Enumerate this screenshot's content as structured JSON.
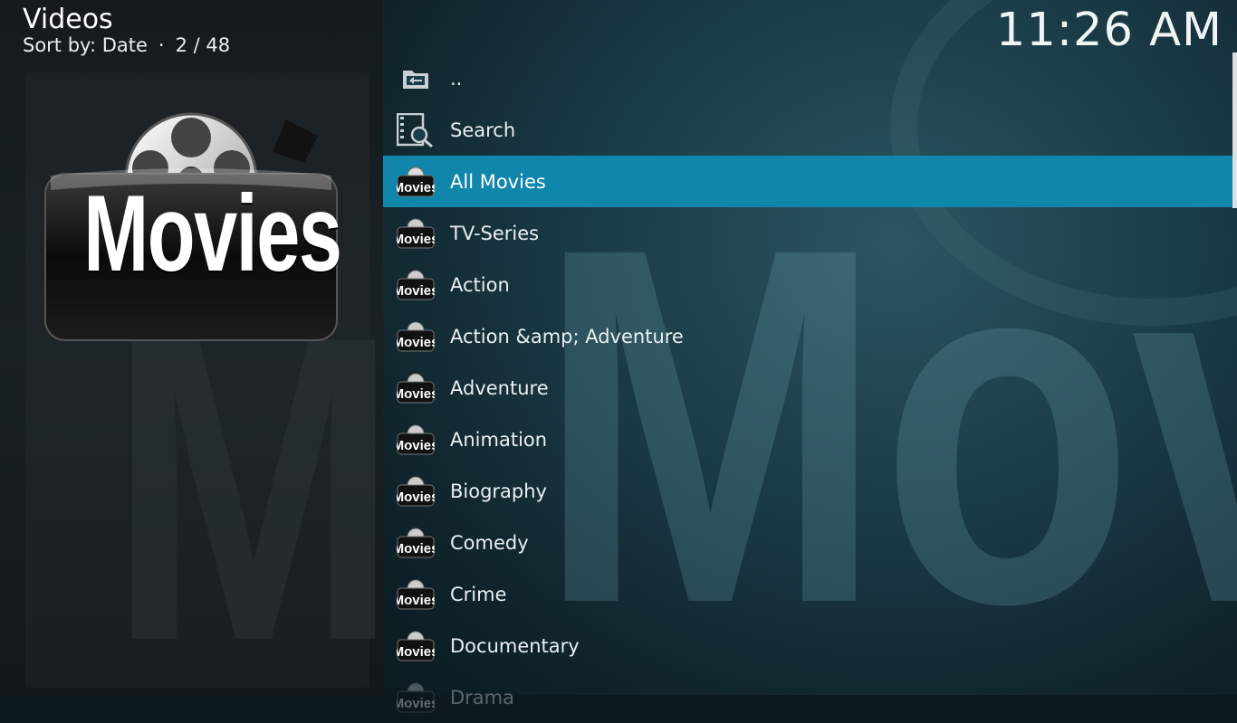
{
  "header": {
    "title": "Videos",
    "sort_label": "Sort by: Date",
    "separator": "·",
    "position": "2 / 48"
  },
  "clock": "11:26 AM",
  "poster": {
    "text": "Movies",
    "icon": "film-reel-icon"
  },
  "background": {
    "watermark_text": "Movies"
  },
  "list": {
    "items": [
      {
        "label": "..",
        "icon": "folder-back-icon"
      },
      {
        "label": "Search",
        "icon": "search-film-icon"
      },
      {
        "label": "All Movies",
        "icon": "movies-reel-icon",
        "selected": true
      },
      {
        "label": "TV-Series",
        "icon": "movies-reel-icon"
      },
      {
        "label": "Action",
        "icon": "movies-reel-icon"
      },
      {
        "label": "Action &amp; Adventure",
        "icon": "movies-reel-icon"
      },
      {
        "label": "Adventure",
        "icon": "movies-reel-icon"
      },
      {
        "label": "Animation",
        "icon": "movies-reel-icon"
      },
      {
        "label": "Biography",
        "icon": "movies-reel-icon"
      },
      {
        "label": "Comedy",
        "icon": "movies-reel-icon"
      },
      {
        "label": "Crime",
        "icon": "movies-reel-icon"
      },
      {
        "label": "Documentary",
        "icon": "movies-reel-icon"
      },
      {
        "label": "Drama",
        "icon": "movies-reel-icon"
      }
    ]
  },
  "colors": {
    "selection": "#0f86aa",
    "text": "#e9eff1"
  }
}
